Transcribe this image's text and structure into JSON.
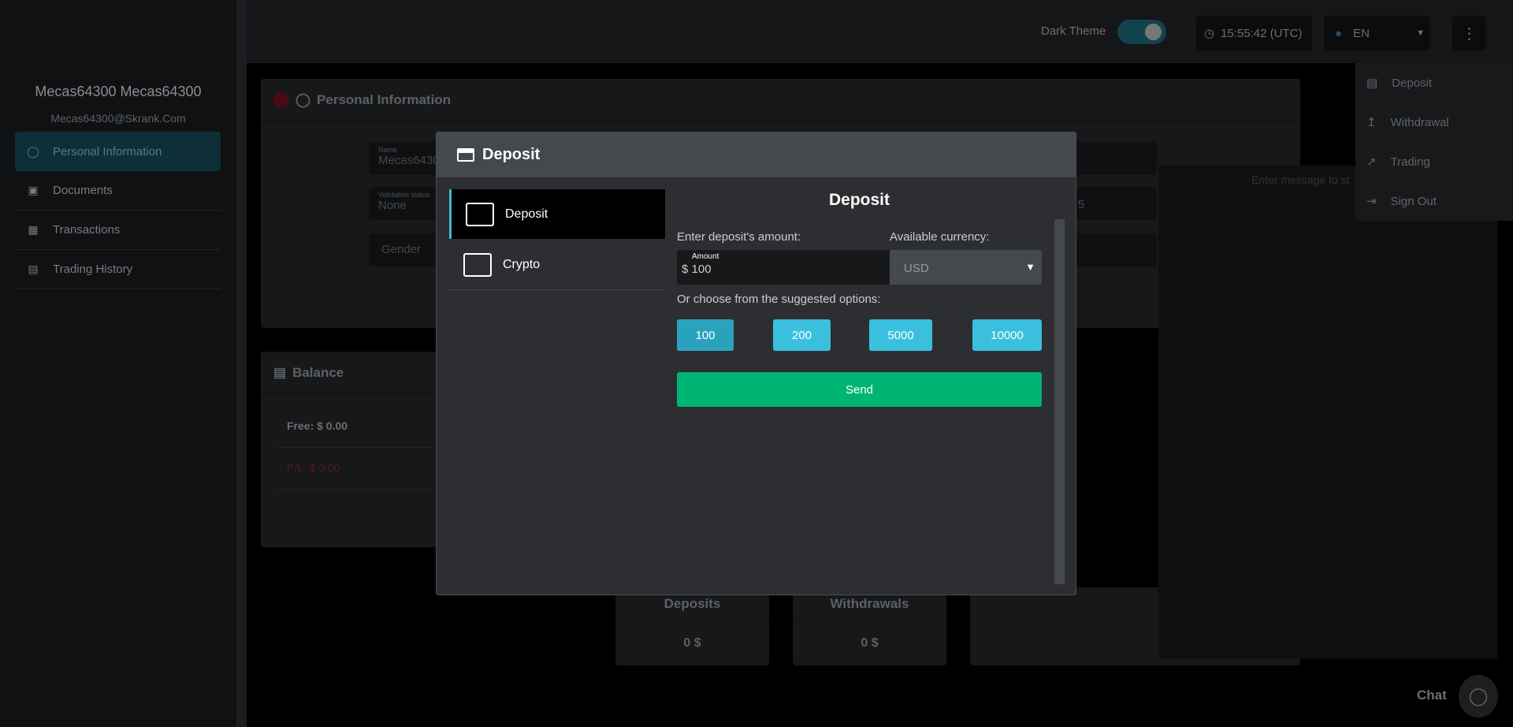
{
  "header": {
    "dark_theme_label": "Dark Theme",
    "dark_theme_on": true,
    "time": "15:55:42 (UTC)",
    "language": "EN"
  },
  "user": {
    "name": "Mecas64300  Mecas64300",
    "email": "Mecas64300@Skrank.Com"
  },
  "sidebar": {
    "items": [
      {
        "label": "Personal Information",
        "icon": "user-icon",
        "active": true
      },
      {
        "label": "Documents",
        "icon": "archive-icon"
      },
      {
        "label": "Transactions",
        "icon": "chip-icon"
      },
      {
        "label": "Trading History",
        "icon": "document-icon"
      }
    ]
  },
  "menu": {
    "items": [
      {
        "label": "Deposit",
        "icon": "card-icon"
      },
      {
        "label": "Withdrawal",
        "icon": "upload-icon"
      },
      {
        "label": "Trading",
        "icon": "trend-icon"
      },
      {
        "label": "Sign Out",
        "icon": "sign-out-icon"
      }
    ]
  },
  "personal": {
    "title": "Personal Information",
    "name_label": "Name",
    "name_value": "Mecas6430",
    "validation_label": "Validation status",
    "validation_value": "None",
    "gender_label": "Gender",
    "partial_value": "5"
  },
  "balance": {
    "title": "Balance",
    "free_label": "Free:",
    "free_value": "$ 0.00",
    "pl_label": "P/L:",
    "pl_value": "$ 0.00"
  },
  "stats": {
    "deposits_label": "Deposits",
    "deposits_value": "0 $",
    "withdrawals_label": "Withdrawals",
    "withdrawals_value": "0 $"
  },
  "chat": {
    "placeholder": "Enter message to st",
    "label": "Chat"
  },
  "modal": {
    "title": "Deposit",
    "tabs": [
      {
        "label": "Deposit",
        "active": true
      },
      {
        "label": "Crypto"
      }
    ],
    "heading": "Deposit",
    "amount_label": "Enter deposit's amount:",
    "currency_label": "Available currency:",
    "amount_field_label": "Amount",
    "amount_value": "$ 100",
    "currency": "USD",
    "suggest_label": "Or choose from the suggested options:",
    "options": [
      "100",
      "200",
      "5000",
      "10000"
    ],
    "send": "Send"
  },
  "colors": {
    "accent": "#3ac0de",
    "send": "#00b574",
    "loss": "#5a1620"
  }
}
